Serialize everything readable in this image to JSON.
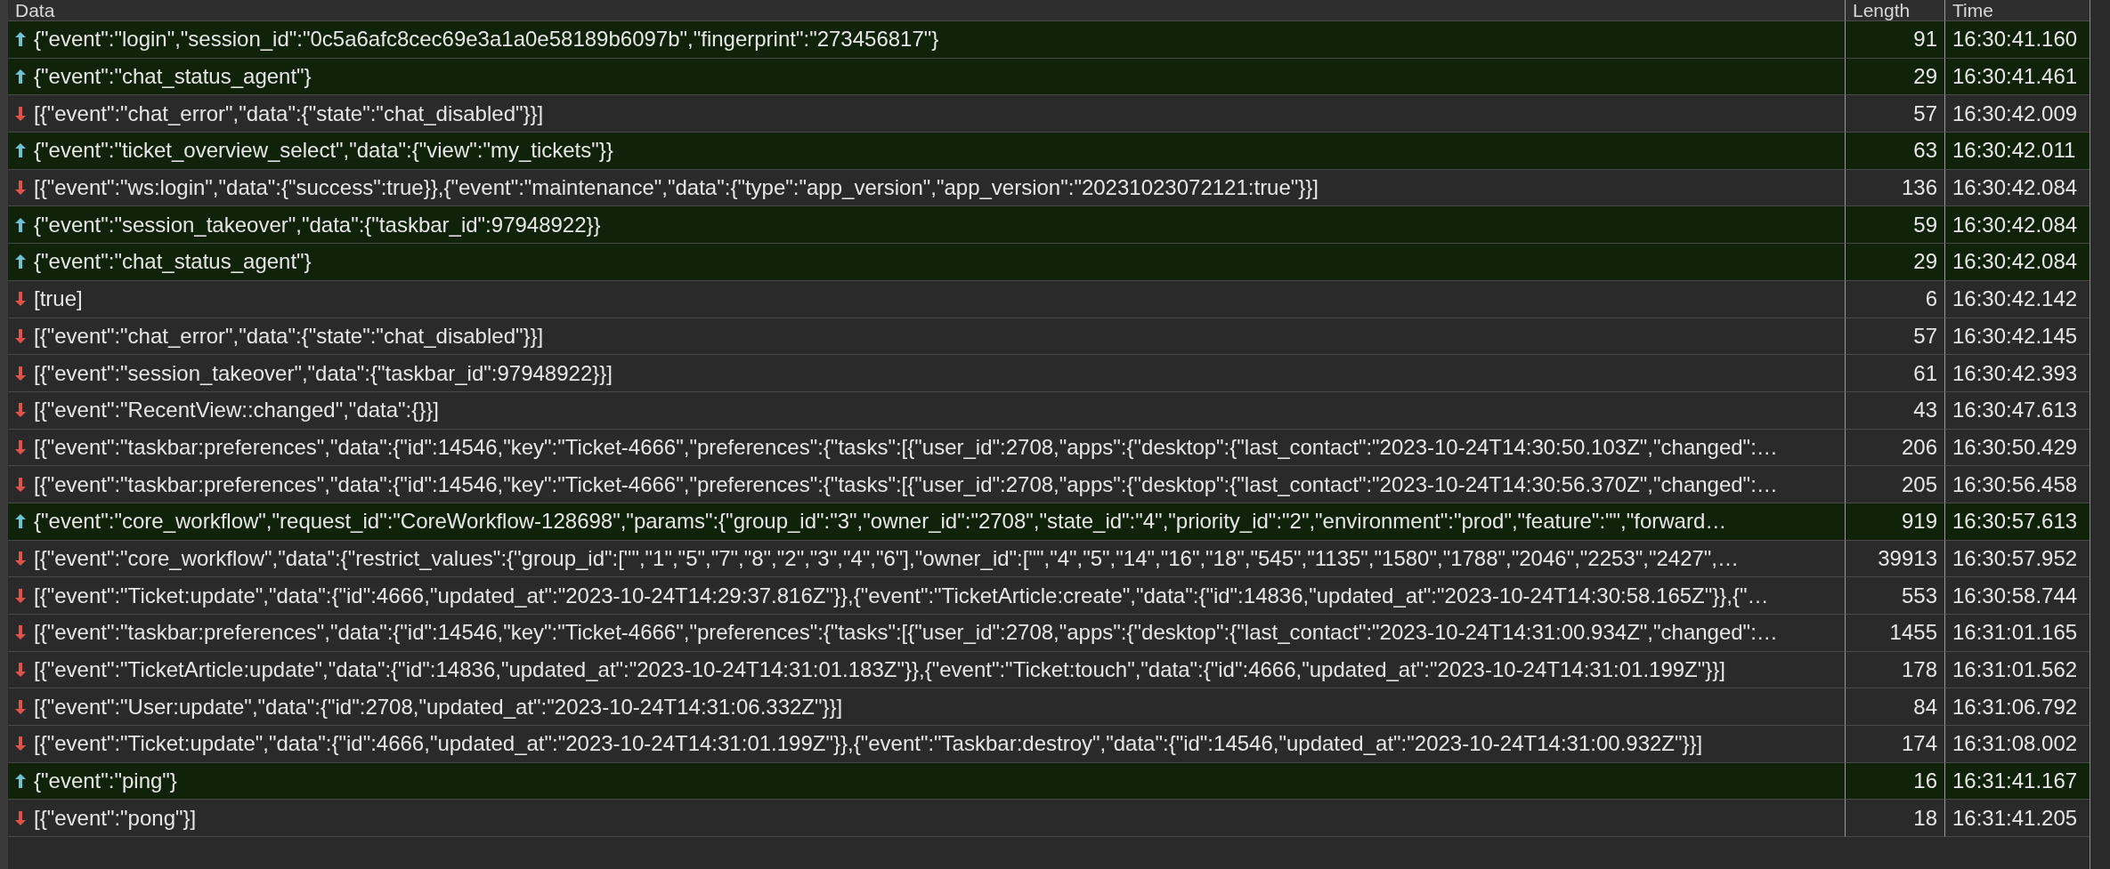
{
  "table": {
    "columns": [
      "Data",
      "Length",
      "Time"
    ],
    "rows": [
      {
        "kind": "sent",
        "data": "{\"event\":\"login\",\"session_id\":\"0c5a6afc8cec69e3a1a0e58189b6097b\",\"fingerprint\":\"273456817\"}",
        "length": "91",
        "time": "16:30:41.160"
      },
      {
        "kind": "sent",
        "data": "{\"event\":\"chat_status_agent\"}",
        "length": "29",
        "time": "16:30:41.461"
      },
      {
        "kind": "received",
        "data": "[{\"event\":\"chat_error\",\"data\":{\"state\":\"chat_disabled\"}}]",
        "length": "57",
        "time": "16:30:42.009"
      },
      {
        "kind": "sent",
        "data": "{\"event\":\"ticket_overview_select\",\"data\":{\"view\":\"my_tickets\"}}",
        "length": "63",
        "time": "16:30:42.011"
      },
      {
        "kind": "received",
        "data": "[{\"event\":\"ws:login\",\"data\":{\"success\":true}},{\"event\":\"maintenance\",\"data\":{\"type\":\"app_version\",\"app_version\":\"20231023072121:true\"}}]",
        "length": "136",
        "time": "16:30:42.084"
      },
      {
        "kind": "sent",
        "data": "{\"event\":\"session_takeover\",\"data\":{\"taskbar_id\":97948922}}",
        "length": "59",
        "time": "16:30:42.084"
      },
      {
        "kind": "sent",
        "data": "{\"event\":\"chat_status_agent\"}",
        "length": "29",
        "time": "16:30:42.084"
      },
      {
        "kind": "received",
        "data": "[true]",
        "length": "6",
        "time": "16:30:42.142"
      },
      {
        "kind": "received",
        "data": "[{\"event\":\"chat_error\",\"data\":{\"state\":\"chat_disabled\"}}]",
        "length": "57",
        "time": "16:30:42.145"
      },
      {
        "kind": "received",
        "data": "[{\"event\":\"session_takeover\",\"data\":{\"taskbar_id\":97948922}}]",
        "length": "61",
        "time": "16:30:42.393"
      },
      {
        "kind": "received",
        "data": "[{\"event\":\"RecentView::changed\",\"data\":{}}]",
        "length": "43",
        "time": "16:30:47.613"
      },
      {
        "kind": "received",
        "data": "[{\"event\":\"taskbar:preferences\",\"data\":{\"id\":14546,\"key\":\"Ticket-4666\",\"preferences\":{\"tasks\":[{\"user_id\":2708,\"apps\":{\"desktop\":{\"last_contact\":\"2023-10-24T14:30:50.103Z\",\"changed\":…",
        "length": "206",
        "time": "16:30:50.429"
      },
      {
        "kind": "received",
        "data": "[{\"event\":\"taskbar:preferences\",\"data\":{\"id\":14546,\"key\":\"Ticket-4666\",\"preferences\":{\"tasks\":[{\"user_id\":2708,\"apps\":{\"desktop\":{\"last_contact\":\"2023-10-24T14:30:56.370Z\",\"changed\":…",
        "length": "205",
        "time": "16:30:56.458"
      },
      {
        "kind": "sent",
        "data": "{\"event\":\"core_workflow\",\"request_id\":\"CoreWorkflow-128698\",\"params\":{\"group_id\":\"3\",\"owner_id\":\"2708\",\"state_id\":\"4\",\"priority_id\":\"2\",\"environment\":\"prod\",\"feature\":\"\",\"forward…",
        "length": "919",
        "time": "16:30:57.613"
      },
      {
        "kind": "received",
        "data": "[{\"event\":\"core_workflow\",\"data\":{\"restrict_values\":{\"group_id\":[\"\",\"1\",\"5\",\"7\",\"8\",\"2\",\"3\",\"4\",\"6\"],\"owner_id\":[\"\",\"4\",\"5\",\"14\",\"16\",\"18\",\"545\",\"1135\",\"1580\",\"1788\",\"2046\",\"2253\",\"2427\",…",
        "length": "39913",
        "time": "16:30:57.952"
      },
      {
        "kind": "received",
        "data": "[{\"event\":\"Ticket:update\",\"data\":{\"id\":4666,\"updated_at\":\"2023-10-24T14:29:37.816Z\"}},{\"event\":\"TicketArticle:create\",\"data\":{\"id\":14836,\"updated_at\":\"2023-10-24T14:30:58.165Z\"}},{\"…",
        "length": "553",
        "time": "16:30:58.744"
      },
      {
        "kind": "received",
        "data": "[{\"event\":\"taskbar:preferences\",\"data\":{\"id\":14546,\"key\":\"Ticket-4666\",\"preferences\":{\"tasks\":[{\"user_id\":2708,\"apps\":{\"desktop\":{\"last_contact\":\"2023-10-24T14:31:00.934Z\",\"changed\":…",
        "length": "1455",
        "time": "16:31:01.165"
      },
      {
        "kind": "received",
        "data": "[{\"event\":\"TicketArticle:update\",\"data\":{\"id\":14836,\"updated_at\":\"2023-10-24T14:31:01.183Z\"}},{\"event\":\"Ticket:touch\",\"data\":{\"id\":4666,\"updated_at\":\"2023-10-24T14:31:01.199Z\"}}]",
        "length": "178",
        "time": "16:31:01.562"
      },
      {
        "kind": "received",
        "data": "[{\"event\":\"User:update\",\"data\":{\"id\":2708,\"updated_at\":\"2023-10-24T14:31:06.332Z\"}}]",
        "length": "84",
        "time": "16:31:06.792"
      },
      {
        "kind": "received",
        "data": "[{\"event\":\"Ticket:update\",\"data\":{\"id\":4666,\"updated_at\":\"2023-10-24T14:31:01.199Z\"}},{\"event\":\"Taskbar:destroy\",\"data\":{\"id\":14546,\"updated_at\":\"2023-10-24T14:31:00.932Z\"}}]",
        "length": "174",
        "time": "16:31:08.002"
      },
      {
        "kind": "sent",
        "data": "{\"event\":\"ping\"}",
        "length": "16",
        "time": "16:31:41.167"
      },
      {
        "kind": "received",
        "data": "[{\"event\":\"pong\"}]",
        "length": "18",
        "time": "16:31:41.205"
      }
    ]
  }
}
